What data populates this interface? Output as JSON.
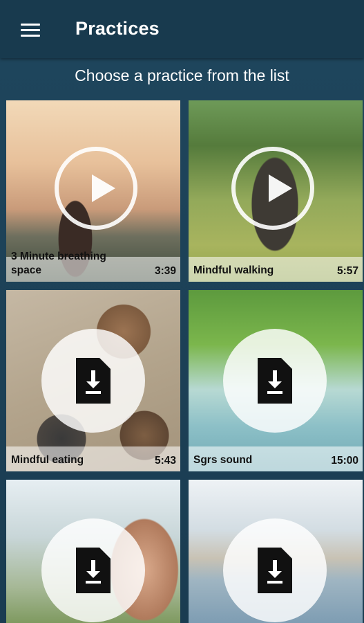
{
  "appbar": {
    "title": "Practices",
    "menu_icon": "menu-icon"
  },
  "subtitle": "Choose a practice from the list",
  "practices": [
    {
      "label": "3 Minute breathing space",
      "duration": "3:39",
      "state": "play",
      "icon": "play-icon"
    },
    {
      "label": "Mindful walking",
      "duration": "5:57",
      "state": "play",
      "icon": "play-icon"
    },
    {
      "label": "Mindful eating",
      "duration": "5:43",
      "state": "download",
      "icon": "download-file-icon"
    },
    {
      "label": "Sgrs sound",
      "duration": "15:00",
      "state": "download",
      "icon": "download-file-icon"
    },
    {
      "label": "",
      "duration": "",
      "state": "download",
      "icon": "download-file-icon"
    },
    {
      "label": "",
      "duration": "",
      "state": "download",
      "icon": "download-file-icon"
    }
  ],
  "colors": {
    "appbar": "#183a4e",
    "background": "#1d4157",
    "caption_overlay": "#ffffffa0",
    "download_doc": "#111111"
  }
}
